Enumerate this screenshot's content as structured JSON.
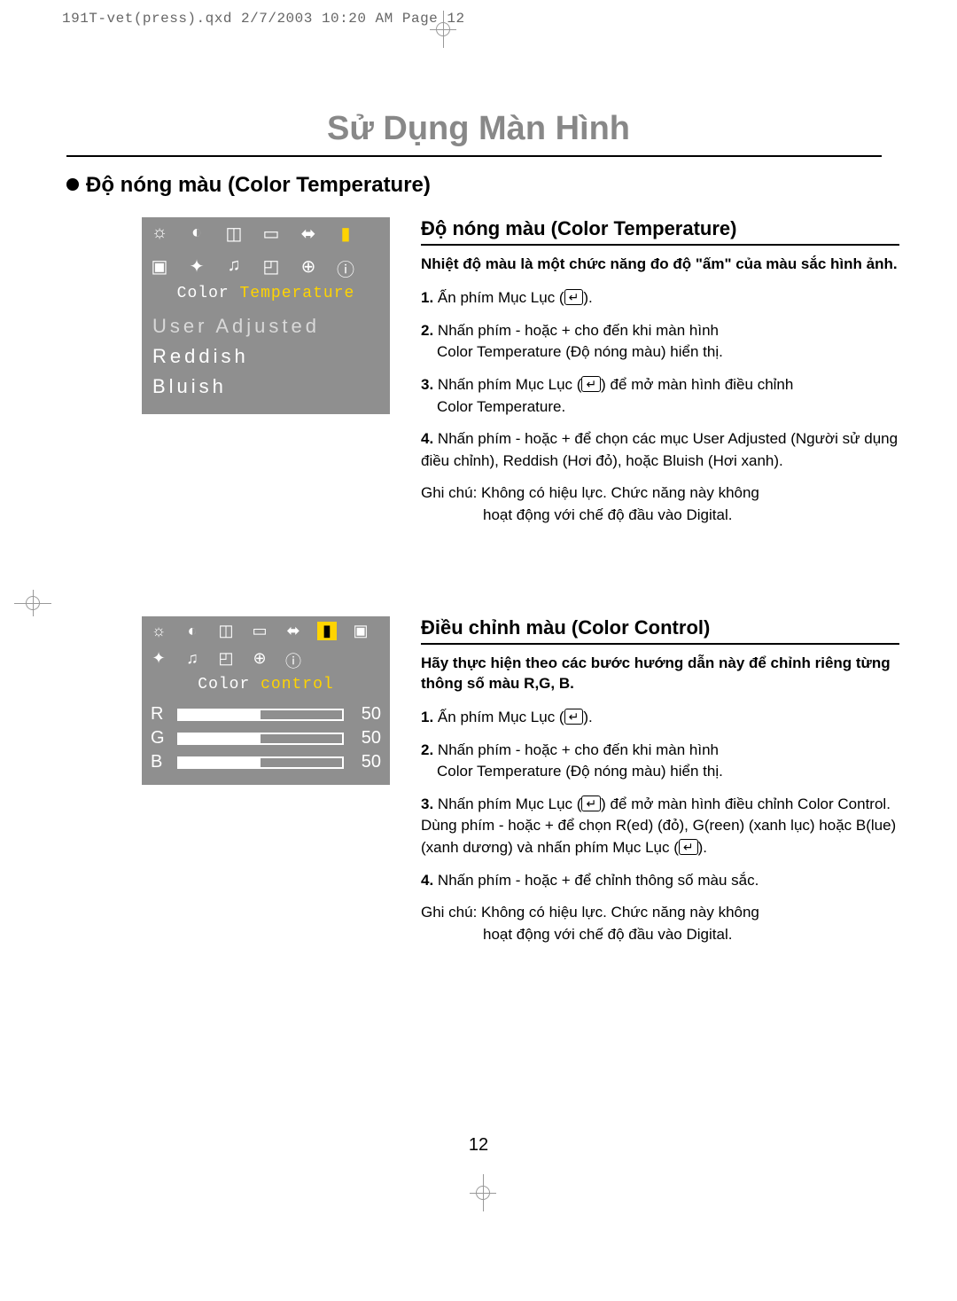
{
  "header": "191T-vet(press).qxd  2/7/2003  10:20 AM  Page 12",
  "page_title": "Sử Dụng Màn Hình",
  "section_heading": "Độ nóng màu (Color Temperature)",
  "osd1": {
    "label_prefix": "Color ",
    "label_highlight": "Temperature",
    "items": {
      "user_adjusted": "User Adjusted",
      "reddish": "Reddish",
      "bluish": "Bluish"
    }
  },
  "osd2": {
    "label_prefix": "Color ",
    "label_highlight": "control",
    "r_label": "R",
    "g_label": "G",
    "b_label": "B",
    "r_val": "50",
    "g_val": "50",
    "b_val": "50"
  },
  "section1": {
    "heading": "Độ nóng màu (Color Temperature)",
    "intro": "Nhiệt độ màu là một chức năng đo độ \"ấm\" của màu sắc hình ảnh.",
    "step1_num": "1.",
    "step1_a": "Ấn phím Mục Lục (",
    "step1_b": ").",
    "step2_num": "2.",
    "step2_a": "Nhấn phím - hoặc + cho đến khi màn hình",
    "step2_b": "Color Temperature (Độ nóng màu) hiển thị.",
    "step3_num": "3.",
    "step3_a": "Nhấn phím Mục Lục (",
    "step3_b": ") để mở màn hình điều chỉnh",
    "step3_c": "Color Temperature.",
    "step4_num": "4.",
    "step4": "Nhấn phím - hoặc + để chọn các mục User Adjusted (Người sử dụng điều chỉnh), Reddish (Hơi đỏ), hoặc Bluish (Hơi xanh).",
    "note_a": "Ghi chú: Không có hiệu lực. Chức năng này không",
    "note_b": "hoạt động với chế độ đầu vào Digital."
  },
  "section2": {
    "heading": "Điều chỉnh màu (Color Control)",
    "intro": "Hãy thực hiện theo các bước hướng dẫn này để chỉnh riêng từng thông số màu R,G, B.",
    "step1_num": "1.",
    "step1_a": "Ấn phím Mục Lục (",
    "step1_b": ").",
    "step2_num": "2.",
    "step2_a": "Nhấn phím - hoặc + cho đến khi màn hình",
    "step2_b": "Color Temperature (Độ nóng màu) hiển thị.",
    "step3_num": "3.",
    "step3_a": "Nhấn phím Mục Lục (",
    "step3_b": ") để mở màn hình điều chỉnh Color Control. Dùng phím - hoặc + để chọn R(ed) (đỏ), G(reen) (xanh lục) hoặc B(lue) (xanh dương) và nhấn phím Mục Lục (",
    "step3_c": ").",
    "step4_num": "4.",
    "step4": "Nhấn phím - hoặc + để chỉnh thông số màu sắc.",
    "note_a": "Ghi chú: Không có hiệu lực. Chức năng này không",
    "note_b": "hoạt động với chế độ đầu vào Digital."
  },
  "page_number": "12"
}
